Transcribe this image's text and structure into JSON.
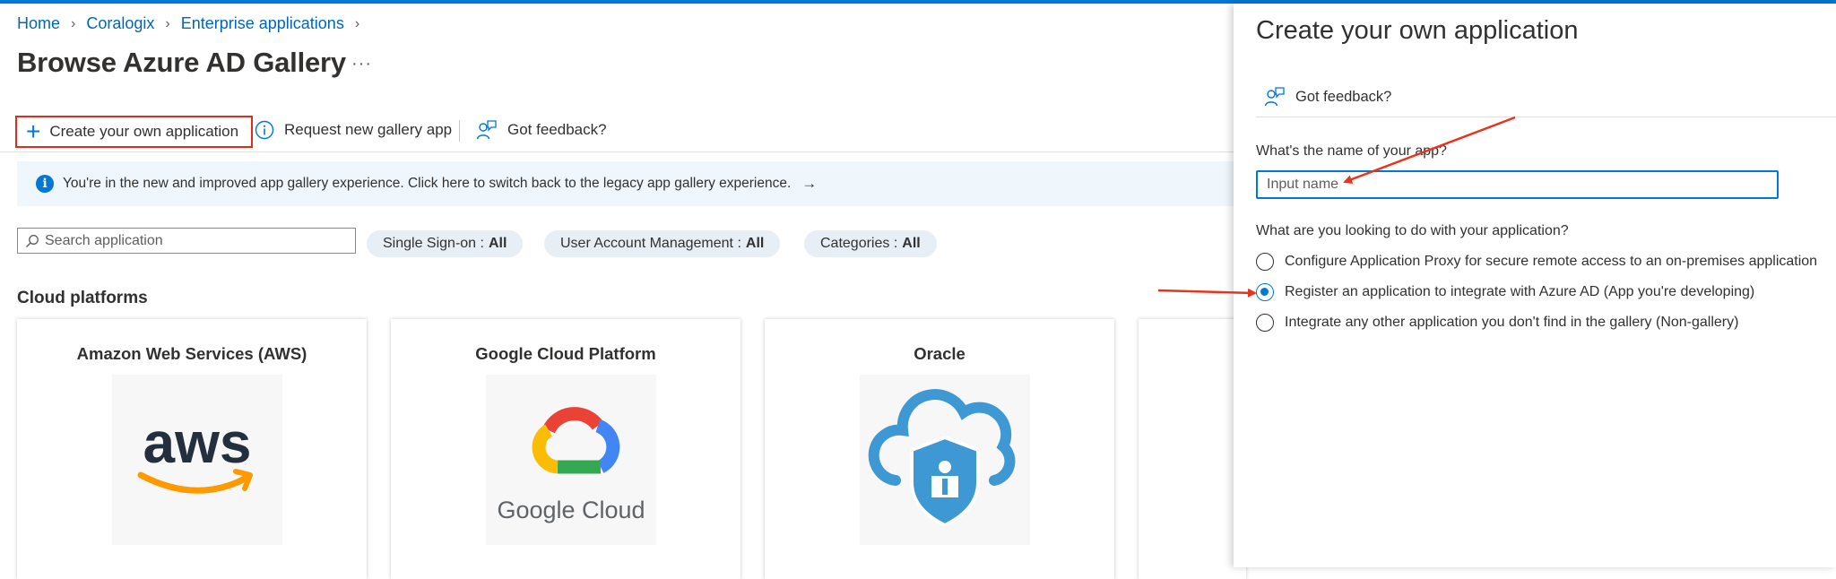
{
  "breadcrumb": [
    {
      "label": "Home"
    },
    {
      "label": "Coralogix"
    },
    {
      "label": "Enterprise applications"
    }
  ],
  "page": {
    "title": "Browse Azure AD Gallery",
    "more": "···"
  },
  "toolbar": {
    "create_label": "Create your own application",
    "request_label": "Request new gallery app",
    "feedback_label": "Got feedback?"
  },
  "banner": {
    "text": "You're in the new and improved app gallery experience. Click here to switch back to the legacy app gallery experience.",
    "arrow": "→"
  },
  "search": {
    "placeholder": "Search application"
  },
  "filters": [
    {
      "label": "Single Sign-on :",
      "value": "All"
    },
    {
      "label": "User Account Management :",
      "value": "All"
    },
    {
      "label": "Categories :",
      "value": "All"
    }
  ],
  "section": {
    "title": "Cloud platforms"
  },
  "cards": [
    {
      "title": "Amazon Web Services (AWS)",
      "logo_text": "aws"
    },
    {
      "title": "Google Cloud Platform",
      "logo_text": "Google Cloud"
    },
    {
      "title": "Oracle"
    }
  ],
  "panel": {
    "title": "Create your own application",
    "feedback_label": "Got feedback?",
    "name_label": "What's the name of your app?",
    "name_placeholder": "Input name",
    "purpose_label": "What are you looking to do with your application?",
    "options": [
      {
        "label": "Configure Application Proxy for secure remote access to an on-premises application",
        "selected": false
      },
      {
        "label": "Register an application to integrate with Azure AD (App you're developing)",
        "selected": true
      },
      {
        "label": "Integrate any other application you don't find in the gallery (Non-gallery)",
        "selected": false
      }
    ]
  },
  "colors": {
    "accent": "#0078d4",
    "highlight": "#d9301e",
    "banner_bg": "#eff6fc"
  }
}
